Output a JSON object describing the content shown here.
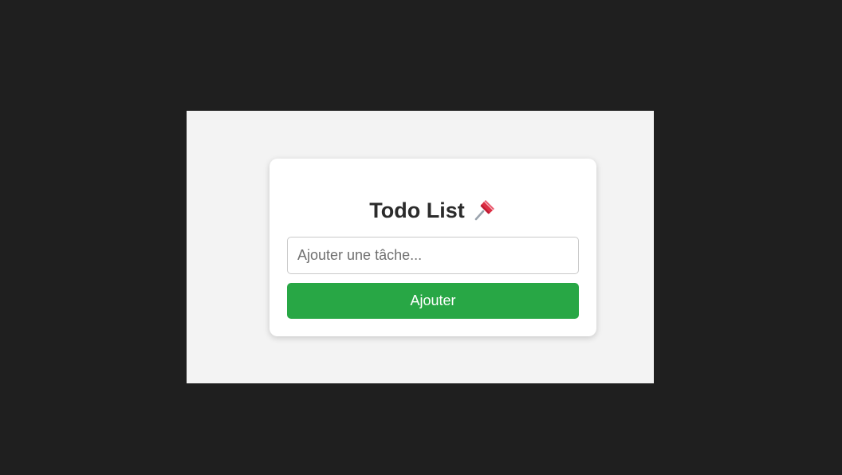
{
  "app": {
    "title": "Todo List",
    "title_icon": "pushpin-icon"
  },
  "form": {
    "input_value": "",
    "input_placeholder": "Ajouter une tâche...",
    "add_label": "Ajouter"
  },
  "colors": {
    "outer_background": "#1f1f1f",
    "page_background": "#f3f3f3",
    "card_background": "#ffffff",
    "accent": "#28a745",
    "pin_red": "#e0245e"
  }
}
